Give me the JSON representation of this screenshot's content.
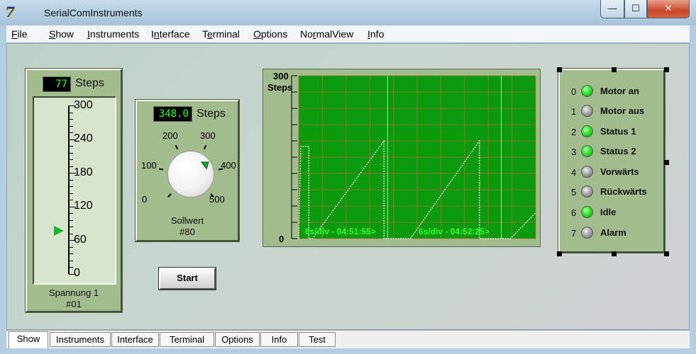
{
  "window": {
    "title": "SerialComInstruments",
    "app_icon": "7",
    "buttons": {
      "minimize": "—",
      "maximize": "☐",
      "close": "✕"
    }
  },
  "menu": {
    "items": [
      {
        "mn": "F",
        "rest": "ile"
      },
      {
        "mn": "S",
        "rest": "how"
      },
      {
        "pre": "",
        "mn": "I",
        "rest": "nstruments"
      },
      {
        "pre": "I",
        "mn": "n",
        "rest": "terface"
      },
      {
        "pre": "T",
        "mn": "e",
        "rest": "rminal"
      },
      {
        "mn": "O",
        "rest": "ptions"
      },
      {
        "pre": "No",
        "mn": "r",
        "rest": "malView"
      },
      {
        "mn": "I",
        "rest": "nfo"
      }
    ]
  },
  "slider_instrument": {
    "value": "77",
    "unit": "Steps",
    "scale_labels": [
      "300",
      "240",
      "180",
      "120",
      "60",
      "0"
    ],
    "caption_line1": "Spannung 1",
    "caption_line2": "#01",
    "level": 77,
    "max": 300
  },
  "knob_instrument": {
    "value": "348.0",
    "unit": "Steps",
    "scale_labels": [
      "0",
      "100",
      "200",
      "300",
      "400",
      "500"
    ],
    "caption_line1": "Sollwert",
    "caption_line2": "#80",
    "level": 348,
    "max": 500
  },
  "start_button": {
    "label": "Start"
  },
  "chart_data": {
    "type": "line",
    "y_top_label": "300",
    "ylabel": "Steps",
    "y_bottom_label": "0",
    "ylim": [
      0,
      300
    ],
    "grid": true,
    "colors": {
      "background": "#0b9a0b",
      "grid": "#b06a3c",
      "line": "#ffffff",
      "label": "#2dff2d"
    },
    "annotations": [
      "6s/div - 04:51:55>",
      "6s/div - 04:52:25>"
    ],
    "series": [
      {
        "values": [
          [
            0.0,
            0
          ],
          [
            0.3,
            170
          ],
          [
            1.5,
            170
          ],
          [
            1.5,
            0
          ],
          [
            2.05,
            0
          ],
          [
            12.6,
            180
          ],
          [
            12.6,
            0
          ],
          [
            16.5,
            0
          ],
          [
            26.7,
            180
          ],
          [
            26.7,
            0
          ],
          [
            31.3,
            0
          ],
          [
            35.0,
            48
          ]
        ]
      }
    ]
  },
  "led_panel": {
    "leds": [
      {
        "index": "0",
        "label": "Motor an",
        "state": "on"
      },
      {
        "index": "1",
        "label": "Motor aus",
        "state": "off"
      },
      {
        "index": "2",
        "label": "Status 1",
        "state": "on"
      },
      {
        "index": "3",
        "label": "Status 2",
        "state": "on"
      },
      {
        "index": "4",
        "label": "Vorwärts",
        "state": "off"
      },
      {
        "index": "5",
        "label": "Rückwärts",
        "state": "off"
      },
      {
        "index": "6",
        "label": "Idle",
        "state": "on"
      },
      {
        "index": "7",
        "label": "Alarm",
        "state": "off"
      }
    ]
  },
  "tabs": [
    {
      "label": "Show",
      "active": true
    },
    {
      "label": "Instruments",
      "active": false
    },
    {
      "label": "Interface",
      "active": false
    },
    {
      "label": "Terminal",
      "active": false
    },
    {
      "label": "Options",
      "active": false
    },
    {
      "label": "Info",
      "active": false
    },
    {
      "label": "Test",
      "active": false
    }
  ]
}
